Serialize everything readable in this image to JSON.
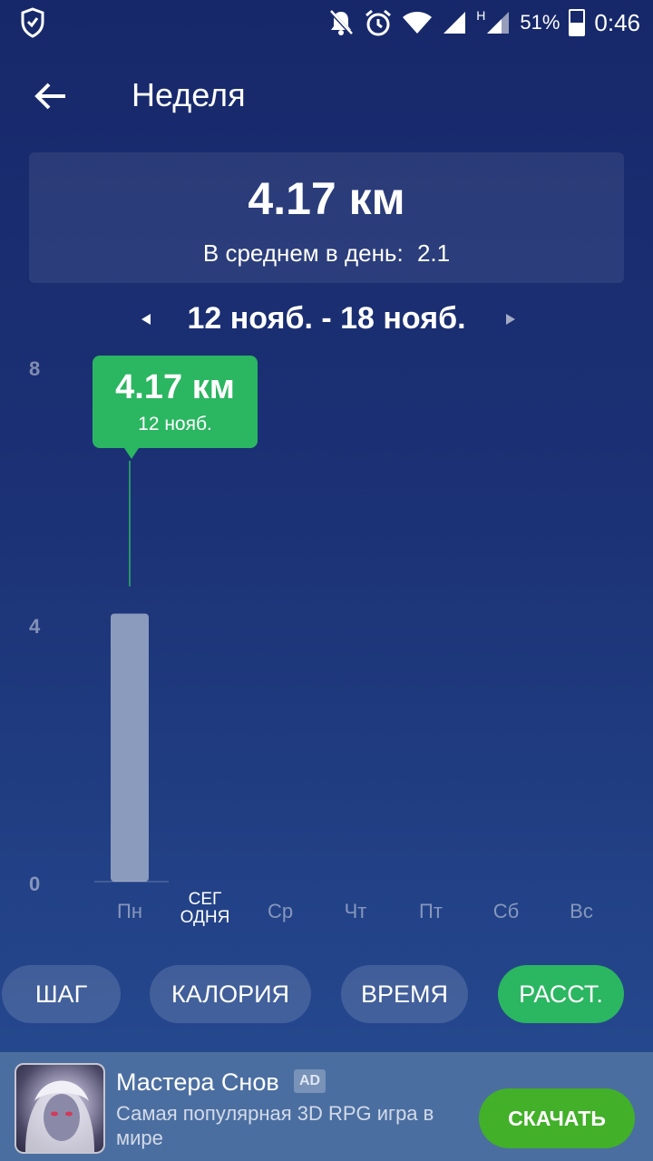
{
  "status_bar": {
    "battery_percent": "51%",
    "time": "0:46",
    "network_label": "H",
    "icons": [
      "shield-icon",
      "bell-off-icon",
      "alarm-icon",
      "wifi-icon",
      "signal-icon",
      "signal-h-icon",
      "battery-icon"
    ]
  },
  "header": {
    "title": "Неделя",
    "back_icon": "arrow-left-icon"
  },
  "summary": {
    "total": "4.17 км",
    "avg_label": "В среднем в день:",
    "avg_value": "2.1"
  },
  "date_nav": {
    "range": "12 нояб. - 18 нояб."
  },
  "tooltip": {
    "value": "4.17 км",
    "date": "12 нояб."
  },
  "chart_data": {
    "type": "bar",
    "categories": [
      "Пн",
      "СЕГ ОДНЯ",
      "Ср",
      "Чт",
      "Пт",
      "Сб",
      "Вс"
    ],
    "x_labels": [
      "Пн",
      "СЕГ",
      "ОДНЯ",
      "Ср",
      "Чт",
      "Пт",
      "Сб",
      "Вс"
    ],
    "values": [
      4.17,
      0,
      0,
      0,
      0,
      0,
      0
    ],
    "y_ticks": [
      "8",
      "4",
      "0"
    ],
    "ylim": [
      0,
      8
    ],
    "selected_index": 0,
    "bar_color": "#8b9bbd",
    "highlight_color": "#2bb661"
  },
  "tabs": [
    {
      "label": "ШАГ",
      "active": false
    },
    {
      "label": "КАЛОРИЯ",
      "active": false
    },
    {
      "label": "ВРЕМЯ",
      "active": false
    },
    {
      "label": "РАССТ.",
      "active": true
    }
  ],
  "ad": {
    "title": "Мастера Снов",
    "badge": "AD",
    "description": "Самая популярная 3D RPG игра в мире",
    "button": "СКАЧАТЬ"
  },
  "colors": {
    "accent": "#2bb661",
    "download": "#42b029",
    "ad_bg": "#4b6ea1"
  }
}
